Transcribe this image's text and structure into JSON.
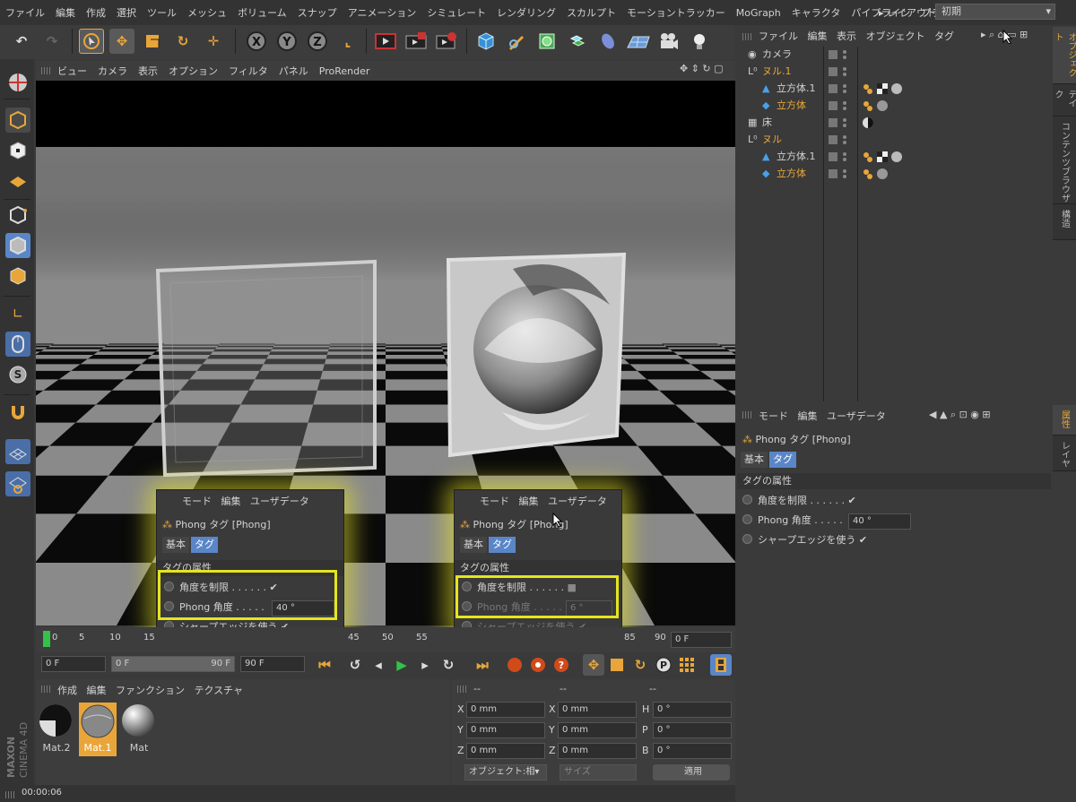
{
  "menu": [
    "ファイル",
    "編集",
    "作成",
    "選択",
    "ツール",
    "メッシュ",
    "ボリューム",
    "スナップ",
    "アニメーション",
    "シミュレート",
    "レンダリング",
    "スカルプト",
    "モーショントラッカー",
    "MoGraph",
    "キャラクタ",
    "パイプライン",
    "プラグイン"
  ],
  "layout": {
    "label": "▸ レイアウト:",
    "value": "初期"
  },
  "toolbar_axes": [
    "X",
    "Y",
    "Z"
  ],
  "viewport_menu": [
    "ビュー",
    "カメラ",
    "表示",
    "オプション",
    "フィルタ",
    "パネル",
    "ProRender"
  ],
  "timeline": {
    "ticks": [
      "0",
      "5",
      "10",
      "15",
      "45",
      "50",
      "55",
      "85",
      "90"
    ],
    "frame_field": "0 F"
  },
  "transport": {
    "start": "0 F",
    "range_start": "0 F",
    "range_end": "90 F",
    "end": "90 F"
  },
  "material_menu": [
    "作成",
    "編集",
    "ファンクション",
    "テクスチャ"
  ],
  "materials": [
    {
      "name": "Mat.2"
    },
    {
      "name": "Mat.1",
      "selected": true
    },
    {
      "name": "Mat"
    }
  ],
  "coords": {
    "header": [
      "--",
      "--",
      "--"
    ],
    "rows": [
      {
        "a": "X",
        "av": "0 mm",
        "b": "X",
        "bv": "0 mm",
        "c": "H",
        "cv": "0 °"
      },
      {
        "a": "Y",
        "av": "0 mm",
        "b": "Y",
        "bv": "0 mm",
        "c": "P",
        "cv": "0 °"
      },
      {
        "a": "Z",
        "av": "0 mm",
        "b": "Z",
        "bv": "0 mm",
        "c": "B",
        "cv": "0 °"
      }
    ],
    "mode_select": "オブジェクト:相▾",
    "size_select": "サイズ",
    "apply": "適用"
  },
  "status": "00:00:06",
  "brand": {
    "maxon": "MAXON",
    "c4d": "CINEMA 4D"
  },
  "object_manager": {
    "menu": [
      "ファイル",
      "編集",
      "表示",
      "オブジェクト",
      "タグ"
    ],
    "objects": [
      {
        "name": "カメラ",
        "indent": 0,
        "color": "#d2d2d2"
      },
      {
        "name": "ヌル.1",
        "indent": 0,
        "color": "#e8a63a"
      },
      {
        "name": "立方体.1",
        "indent": 1,
        "color": "#d2d2d2"
      },
      {
        "name": "立方体",
        "indent": 1,
        "color": "#e8a63a"
      },
      {
        "name": "床",
        "indent": 0,
        "color": "#d2d2d2"
      },
      {
        "name": "ヌル",
        "indent": 0,
        "color": "#e8a63a"
      },
      {
        "name": "立方体.1",
        "indent": 1,
        "color": "#d2d2d2"
      },
      {
        "name": "立方体",
        "indent": 1,
        "color": "#e8a63a"
      }
    ]
  },
  "right_tabs_top": [
    "オブジェクト",
    "テイク",
    "コンテンツブラウザ",
    "構造"
  ],
  "right_tabs_bottom": [
    "属性",
    "レイヤ"
  ],
  "attributes": {
    "menu": [
      "モード",
      "編集",
      "ユーザデータ"
    ],
    "title": "Phong タグ [Phong]",
    "tabs": [
      "基本",
      "タグ"
    ],
    "section": "タグの属性",
    "limit_label": "角度を制限 . . . . . .",
    "limit_value": "✔",
    "angle_label": "Phong 角度 . . . . .",
    "angle_value": "40 °",
    "sharp_label": "シャープエッジを使う",
    "sharp_value": "✔"
  },
  "popup_left": {
    "menu": [
      "モード",
      "編集",
      "ユーザデータ"
    ],
    "title": "Phong タグ [Phong]",
    "tabs": [
      "基本",
      "タグ"
    ],
    "section": "タグの属性",
    "limit_label": "角度を制限 . . . . . .",
    "limit_value": "✔",
    "angle_label": "Phong 角度 . . . . .",
    "angle_value": "40 °",
    "sharp_label": "シャープエッジを使う",
    "sharp_value": "✔"
  },
  "popup_right": {
    "menu": [
      "モード",
      "編集",
      "ユーザデータ"
    ],
    "title": "Phong タグ [Phong]",
    "tabs": [
      "基本",
      "タグ"
    ],
    "section": "タグの属性",
    "limit_label": "角度を制限 . . . . . .",
    "limit_value": "■",
    "angle_label": "Phong 角度 . . . . .",
    "angle_value": "6 °",
    "sharp_label": "シャープエッジを使う",
    "sharp_value": "✔"
  },
  "colors": {
    "accent": "#e8a63a",
    "highlight": "#e6e51c",
    "tab_blue": "#5a86c8"
  }
}
